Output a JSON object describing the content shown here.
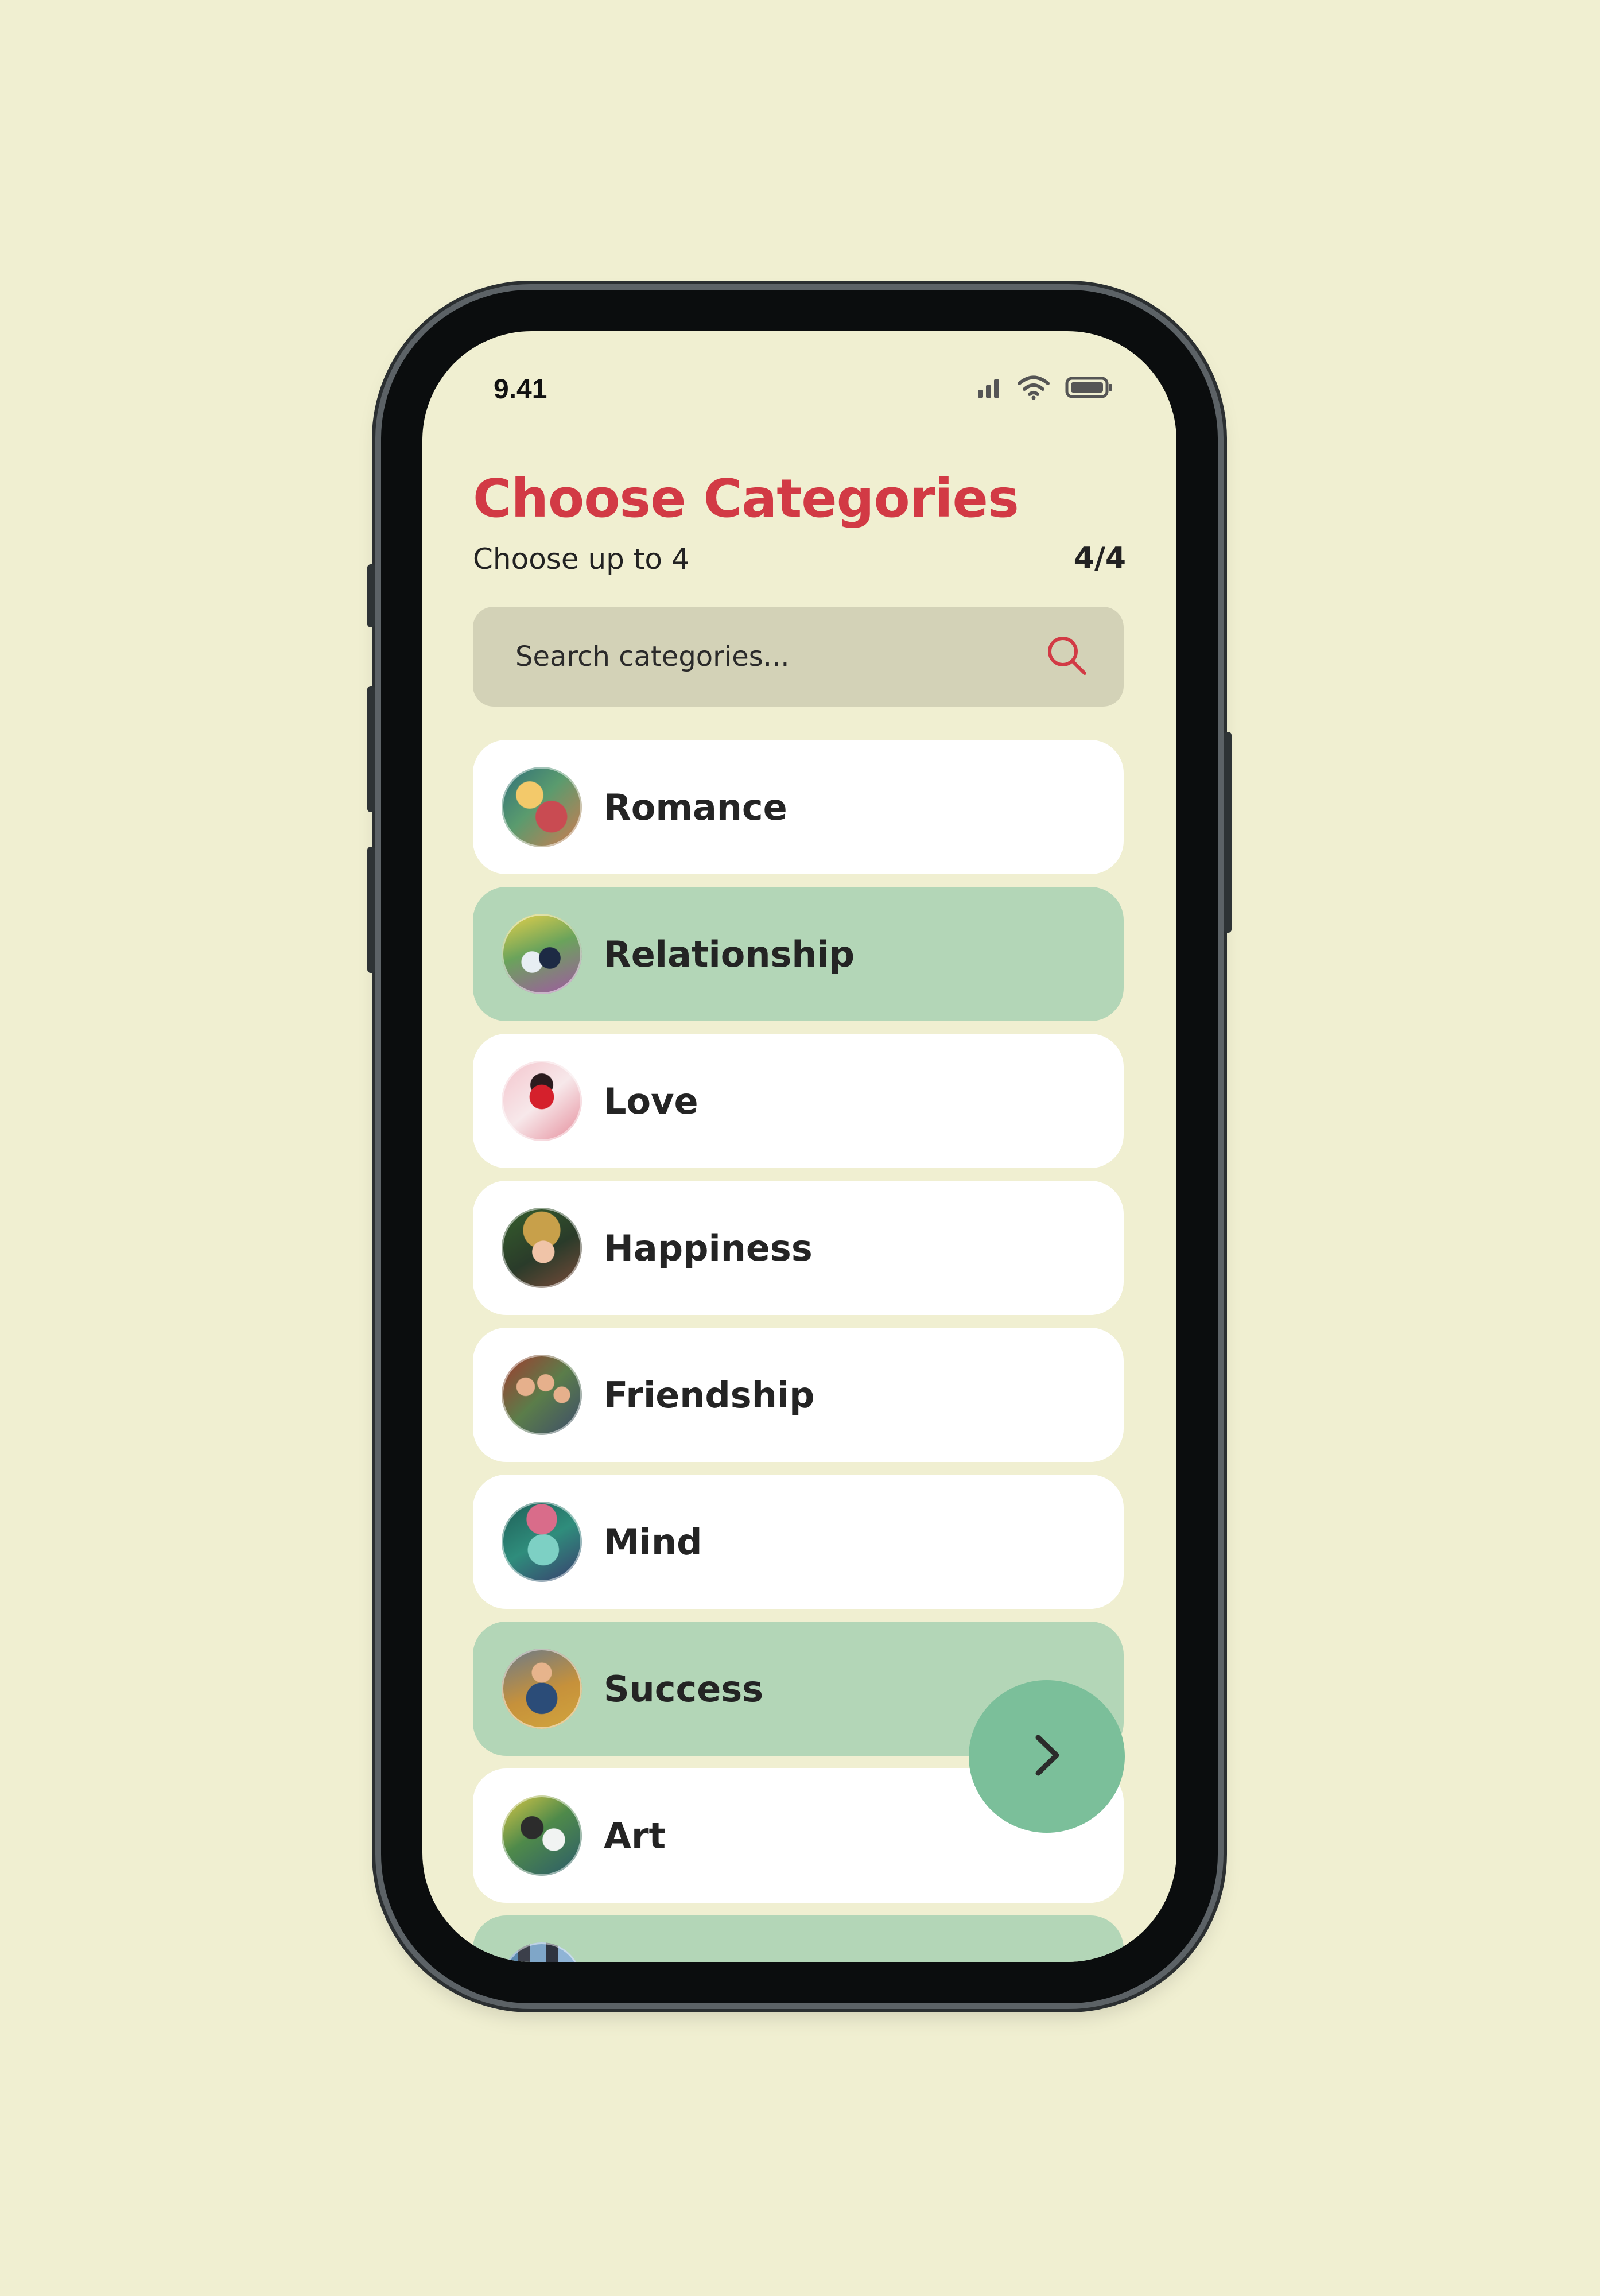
{
  "status_bar": {
    "time": "9.41",
    "icons": [
      "signal-icon",
      "wifi-icon",
      "battery-icon"
    ]
  },
  "header": {
    "title": "Choose Categories",
    "subtitle": "Choose up to 4",
    "counter": "4/4"
  },
  "search": {
    "placeholder": "Search categories...",
    "icon": "search-icon"
  },
  "categories": [
    {
      "label": "Romance",
      "selected": false
    },
    {
      "label": "Relationship",
      "selected": true
    },
    {
      "label": "Love",
      "selected": false
    },
    {
      "label": "Happiness",
      "selected": false
    },
    {
      "label": "Friendship",
      "selected": false
    },
    {
      "label": "Mind",
      "selected": false
    },
    {
      "label": "Success",
      "selected": true
    },
    {
      "label": "Art",
      "selected": false
    },
    {
      "label": "",
      "selected": true
    }
  ],
  "next_button": {
    "icon": "chevron-right-icon"
  },
  "colors": {
    "background": "#f0efd1",
    "accent": "#d23a45",
    "selected": "#b3d6b7",
    "fab": "#7bbf9a",
    "search_bg": "#d3d2b7"
  }
}
